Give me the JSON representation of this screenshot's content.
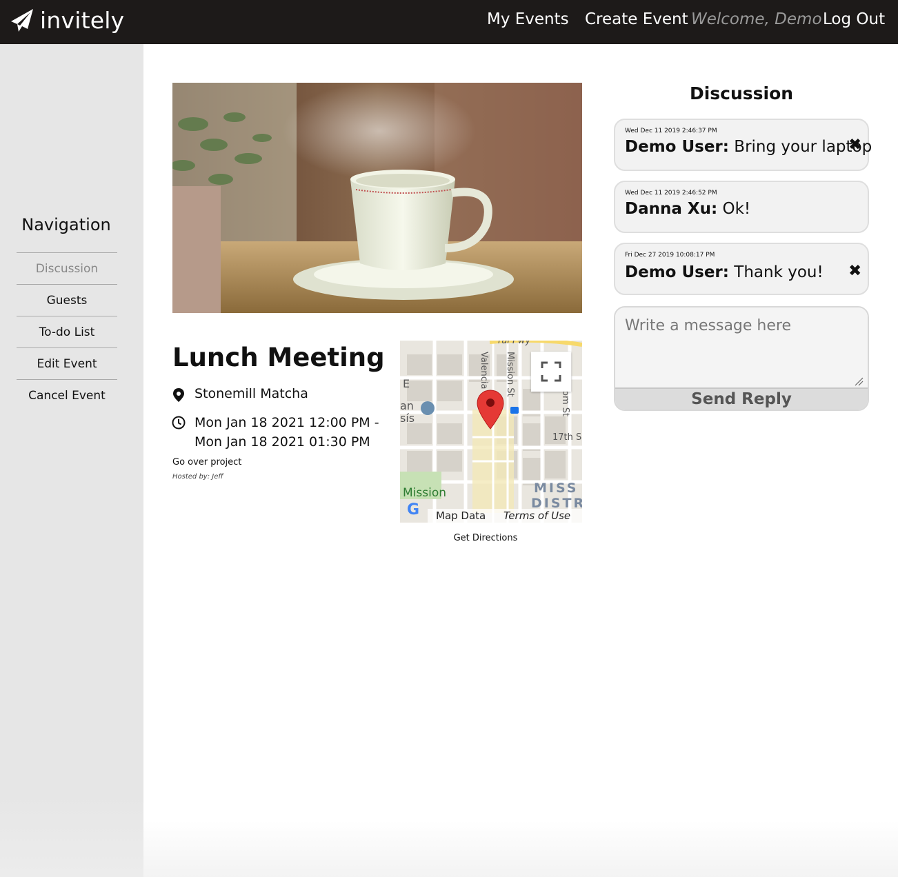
{
  "header": {
    "logo_text": "invitely",
    "nav": {
      "my_events": "My Events",
      "create_event": "Create Event",
      "welcome": "Welcome, Demo",
      "log_out": "Log Out"
    }
  },
  "sidebar": {
    "title": "Navigation",
    "items": [
      {
        "label": "Discussion",
        "active": true
      },
      {
        "label": "Guests",
        "active": false
      },
      {
        "label": "To-do List",
        "active": false
      },
      {
        "label": "Edit Event",
        "active": false
      },
      {
        "label": "Cancel Event",
        "active": false
      }
    ]
  },
  "event": {
    "title": "Lunch Meeting",
    "location": "Stonemill Matcha",
    "time_line1": "Mon Jan 18 2021 12:00 PM -",
    "time_line2": "Mon Jan 18 2021 01:30 PM",
    "description": "Go over project",
    "host": "Hosted by: Jeff"
  },
  "map": {
    "labels": {
      "valencia": "Valencia",
      "mission_st": "Mission St",
      "om_st": "om St",
      "seventeenth": "17th S",
      "mission": "Mission",
      "miss": "MISS",
      "distr": "DISTR",
      "e": "E",
      "an": "an",
      "sis": "sís",
      "pwy": "ral Pwy"
    },
    "map_data": "Map Data",
    "terms": "Terms of Use",
    "directions": "Get Directions"
  },
  "discussion": {
    "title": "Discussion",
    "messages": [
      {
        "timestamp": "Wed Dec 11 2019 2:46:37 PM",
        "author": "Demo User:",
        "text": " Bring your laptop",
        "deletable": true
      },
      {
        "timestamp": "Wed Dec 11 2019 2:46:52 PM",
        "author": "Danna Xu:",
        "text": " Ok!",
        "deletable": false
      },
      {
        "timestamp": "Fri Dec 27 2019 10:08:17 PM",
        "author": "Demo User:",
        "text": " Thank you!",
        "deletable": true
      }
    ],
    "delete_symbol": "✖",
    "reply_placeholder": "Write a message here",
    "send_label": "Send Reply"
  },
  "colors": {
    "topbar": "#1d1a19",
    "sidebar": "#e6e6e6",
    "message_bg": "#f2f2f2",
    "map_pin": "#e53935"
  }
}
